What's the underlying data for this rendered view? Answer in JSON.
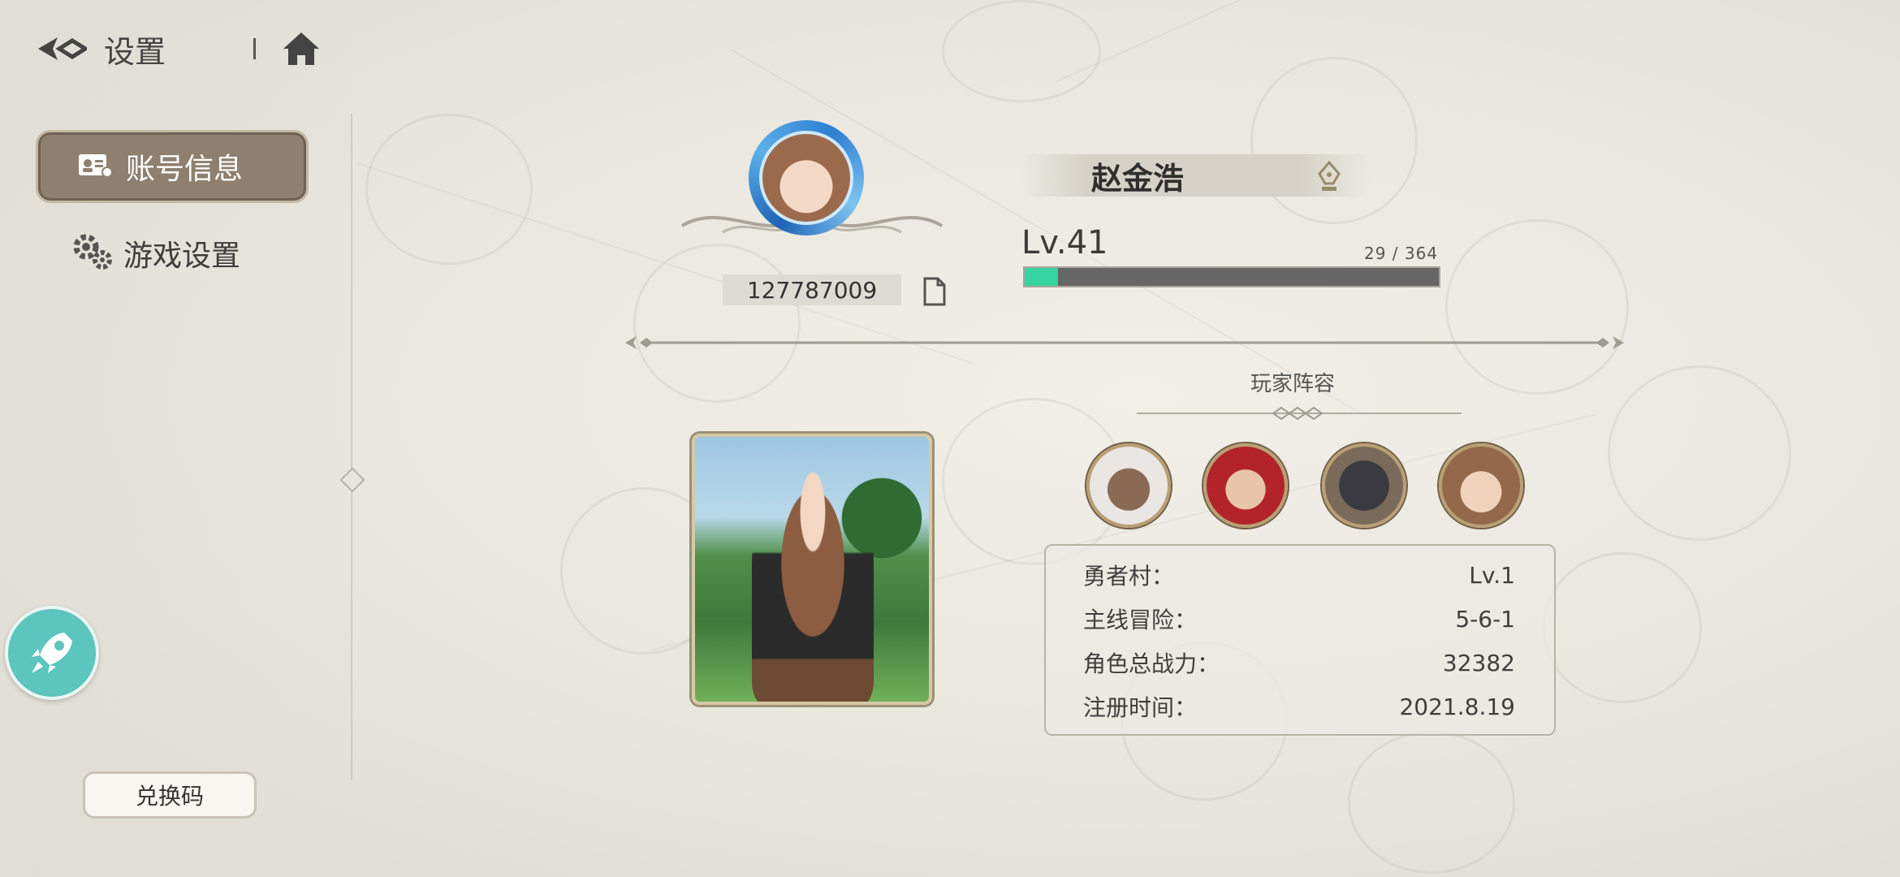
{
  "header": {
    "title": "设置",
    "back_icon": "back-arrow-icon",
    "home_icon": "home-icon"
  },
  "sidebar": {
    "items": [
      {
        "label": "账号信息",
        "icon": "id-card-icon",
        "active": true
      },
      {
        "label": "游戏设置",
        "icon": "gears-icon",
        "active": false
      }
    ],
    "redeem_label": "兑换码",
    "rocket_icon": "rocket-icon"
  },
  "profile": {
    "uid": "127787009",
    "name": "赵金浩",
    "level": "Lv.41",
    "exp_text": "29 / 364",
    "exp_fraction": 0.08
  },
  "lineup": {
    "title": "玩家阵容",
    "characters": [
      {
        "icon": "character-white-hair-icon"
      },
      {
        "icon": "character-red-hair-icon"
      },
      {
        "icon": "character-dark-armor-icon"
      },
      {
        "icon": "character-brown-hair-icon"
      }
    ]
  },
  "stats": [
    {
      "key": "勇者村：",
      "value": "Lv.1"
    },
    {
      "key": "主线冒险：",
      "value": "5-6-1"
    },
    {
      "key": "角色总战力：",
      "value": "32382"
    },
    {
      "key": "注册时间：",
      "value": "2021.8.19"
    }
  ],
  "colors": {
    "accent": "#36d4a0",
    "nav_active": "#8e7f6f",
    "rocket": "#5cc5bd"
  }
}
